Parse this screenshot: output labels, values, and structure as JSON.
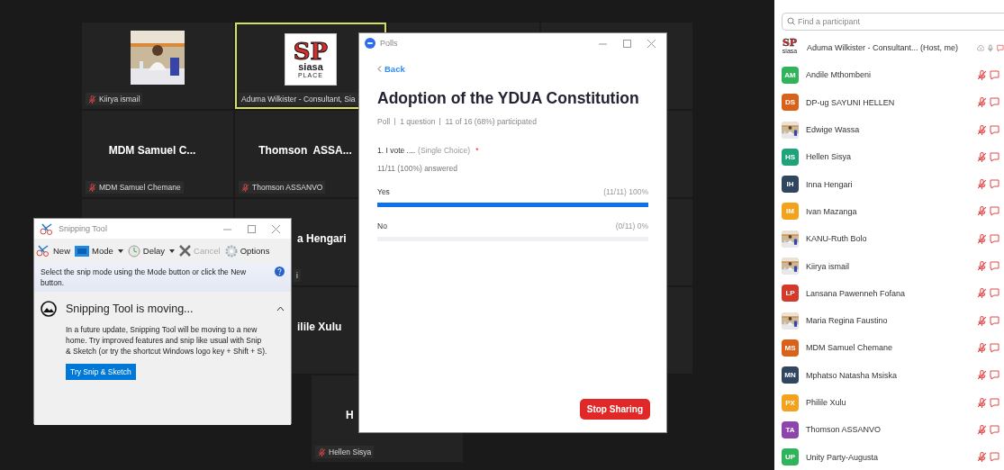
{
  "video_grid": {
    "rows": [
      {
        "tiles": [
          {
            "label": "Kiirya ismail",
            "muted": true,
            "highlighted": false
          },
          {
            "kind": "logo",
            "logo": {
              "mark": "SP",
              "word": "siasa",
              "sub": "PLACE"
            },
            "label": "Aduma Wilkister - Consultant, Sia",
            "muted": false,
            "highlighted": true
          },
          {
            "kind": "blank"
          },
          {
            "kind": "blank"
          }
        ]
      },
      {
        "tiles": [
          {
            "kind": "name",
            "name": "MDM Samuel C...",
            "label": "MDM Samuel Chemane",
            "muted": true,
            "highlighted": false
          },
          {
            "kind": "name",
            "name": "Thomson  ASSA...",
            "label": "Thomson ASSANVO",
            "muted": true,
            "highlighted": false
          },
          {
            "kind": "hidden"
          },
          {
            "kind": "blank"
          }
        ]
      },
      {
        "tiles": [
          {
            "kind": "blank"
          },
          {
            "kind": "partial",
            "name": "a Hengari",
            "label": "i",
            "muted": false,
            "highlighted": false
          },
          {
            "kind": "hidden"
          },
          {
            "kind": "blank"
          }
        ]
      },
      {
        "tiles": [
          {
            "kind": "hidden"
          },
          {
            "kind": "partial",
            "name": "ilile Xulu",
            "highlighted": false
          },
          {
            "kind": "hidden"
          },
          {
            "kind": "blank"
          }
        ]
      },
      {
        "tiles": [
          {
            "kind": "cut",
            "name": "H",
            "label": "Hellen Sisya",
            "muted": true,
            "highlighted": false
          }
        ]
      }
    ]
  },
  "snipping_tool": {
    "title": "Snipping Tool",
    "toolbar": [
      {
        "label": "New",
        "dropdown": false,
        "disabled": false
      },
      {
        "label": "Mode",
        "dropdown": true,
        "disabled": false
      },
      {
        "label": "Delay",
        "dropdown": true,
        "disabled": false
      },
      {
        "label": "Cancel",
        "dropdown": false,
        "disabled": true
      },
      {
        "label": "Options",
        "dropdown": false,
        "disabled": false
      }
    ],
    "info": "Select the snip mode using the Mode button or click the New button.",
    "notice": {
      "title": "Snipping Tool is moving...",
      "expanded": true,
      "body": "In a future update, Snipping Tool will be moving to a new home. Try improved features and snip like usual with Snip & Sketch (or try the shortcut Windows logo key + Shift + S).",
      "button": "Try Snip & Sketch"
    }
  },
  "polls": {
    "window_title": "Polls",
    "back": "Back",
    "title": "Adoption of the YDUA Constitution",
    "meta": [
      "Poll",
      "1 question",
      "11 of 16 (68%) participated"
    ],
    "question": {
      "text": "1. I vote ....",
      "type": "(Single Choice)",
      "required_mark": "*",
      "answered": "11/11 (100%) answered"
    },
    "options": [
      {
        "label": "Yes",
        "reading": "(11/11) 100%",
        "level": 1
      },
      {
        "label": "No",
        "reading": "(0/11) 0%",
        "level": 0
      }
    ],
    "stop_button": "Stop Sharing"
  },
  "participants": {
    "search": {
      "placeholder": "Find a participant"
    },
    "items": [
      {
        "name": "Aduma Wilkister - Consultant... (Host, me)",
        "avatar": {
          "kind": "logo",
          "mark": "SP",
          "word": "siasa"
        },
        "recording": true,
        "muted": false
      },
      {
        "name": "Andile Mthombeni",
        "avatar": {
          "kind": "initials",
          "initials": "AM",
          "color": "#2fb35b"
        },
        "muted": true
      },
      {
        "name": "DP-ug SAYUNI HELLEN",
        "avatar": {
          "kind": "initials",
          "initials": "DS",
          "color": "#d9611a"
        },
        "muted": true
      },
      {
        "name": "Edwige Wassa",
        "muted": true
      },
      {
        "name": "Hellen Sisya",
        "avatar": {
          "kind": "initials",
          "initials": "HS",
          "color": "#1fa37a"
        },
        "muted": true
      },
      {
        "name": "Inna Hengari",
        "avatar": {
          "kind": "initials",
          "initials": "IH",
          "color": "#2f4560"
        },
        "muted": true
      },
      {
        "name": "Ivan Mazanga",
        "avatar": {
          "kind": "initials",
          "initials": "IM",
          "color": "#f2a21b"
        },
        "muted": true
      },
      {
        "name": "KANU-Ruth Bolo",
        "muted": true
      },
      {
        "name": "Kiirya ismail",
        "muted": true
      },
      {
        "name": "Lansana Pawenneh Fofana",
        "avatar": {
          "kind": "initials",
          "initials": "LP",
          "color": "#d33a2c"
        },
        "muted": true
      },
      {
        "name": "Maria Regina Faustino",
        "muted": true
      },
      {
        "name": "MDM Samuel Chemane",
        "avatar": {
          "kind": "initials",
          "initials": "MS",
          "color": "#d9611a"
        },
        "muted": true
      },
      {
        "name": "Mphatso Natasha Msiska",
        "avatar": {
          "kind": "initials",
          "initials": "MN",
          "color": "#2f4560"
        },
        "muted": true
      },
      {
        "name": "Philile Xulu",
        "avatar": {
          "kind": "initials",
          "initials": "PX",
          "color": "#f2a21b"
        },
        "muted": true
      },
      {
        "name": "Thomson ASSANVO",
        "avatar": {
          "kind": "initials",
          "initials": "TA",
          "color": "#8e44ad"
        },
        "muted": true
      },
      {
        "name": "Unity Party-Augusta",
        "avatar": {
          "kind": "initials",
          "initials": "UP",
          "color": "#2fb35b"
        },
        "muted": true
      }
    ]
  }
}
